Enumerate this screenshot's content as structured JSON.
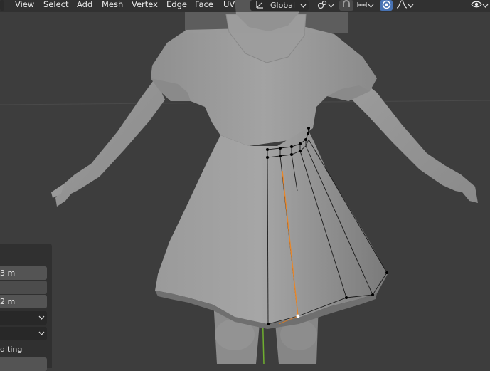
{
  "header": {
    "menus": [
      "View",
      "Select",
      "Add",
      "Mesh",
      "Vertex",
      "Edge",
      "Face",
      "UV"
    ],
    "transform_orientation": "Global"
  },
  "icons": {
    "orientation": "transform-orientation-icon",
    "pivot": "pivot-point-icon",
    "snap": "snap-magnet-icon",
    "snap_target": "snap-increment-icon",
    "proportional": "proportional-editing-icon",
    "falloff": "falloff-curve-icon",
    "visibility": "eye-visibility-icon"
  },
  "redo_panel": {
    "value_1": "3 m",
    "value_2": "2 m",
    "checkbox_label": "diting"
  },
  "colors": {
    "viewport_bg": "#3d3d3d",
    "header_bg": "#262626",
    "active_button": "#4772b3",
    "selected_edge": "#e8872a",
    "y_axis": "#6fae2f"
  }
}
